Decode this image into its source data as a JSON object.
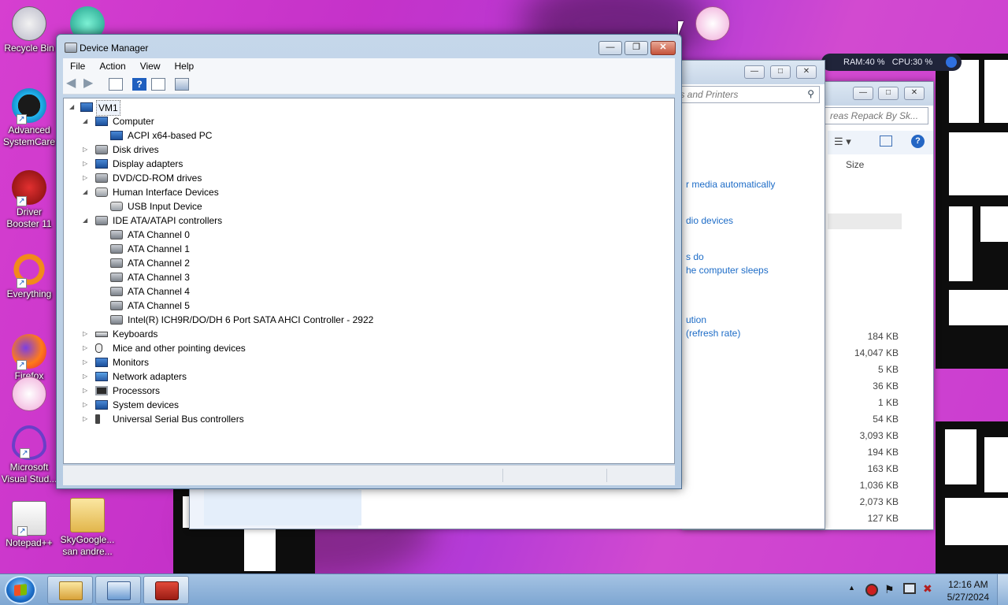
{
  "desktop": {
    "icons": [
      {
        "label": "Recycle Bin"
      },
      {
        "label": "Advanced SystemCare"
      },
      {
        "label": "Driver Booster 11"
      },
      {
        "label": "Everything"
      },
      {
        "label": "Firefox"
      },
      {
        "label": "Microsoft Visual Stud..."
      },
      {
        "label": "Notepad++"
      },
      {
        "label": "SkyGoogle... san andre..."
      }
    ]
  },
  "monitor_widget": {
    "ram": "RAM:40 %",
    "cpu": "CPU:30 %"
  },
  "back_window_1": {
    "search_placeholder": "ices and Printers",
    "links": [
      "r media automatically",
      "dio devices",
      "s do",
      "he computer sleeps",
      "ution",
      "(refresh rate)"
    ]
  },
  "back_window_2": {
    "search_placeholder": "reas Repack By Sk...",
    "column_size": "Size",
    "sizes": [
      "184 KB",
      "14,047 KB",
      "5 KB",
      "36 KB",
      "1 KB",
      "54 KB",
      "3,093 KB",
      "194 KB",
      "163 KB",
      "1,036 KB",
      "2,073 KB",
      "127 KB"
    ]
  },
  "device_manager": {
    "title": "Device Manager",
    "menu": [
      "File",
      "Action",
      "View",
      "Help"
    ],
    "tree": {
      "root": "VM1",
      "items": [
        {
          "label": "Computer",
          "level": 1,
          "expanded": true,
          "icon": "computer-icon"
        },
        {
          "label": "ACPI x64-based PC",
          "level": 2,
          "icon": "computer-icon"
        },
        {
          "label": "Disk drives",
          "level": 1,
          "expanded": false,
          "icon": "disk-icon"
        },
        {
          "label": "Display adapters",
          "level": 1,
          "expanded": false,
          "icon": "display-icon"
        },
        {
          "label": "DVD/CD-ROM drives",
          "level": 1,
          "expanded": false,
          "icon": "dvd-icon"
        },
        {
          "label": "Human Interface Devices",
          "level": 1,
          "expanded": true,
          "icon": "hid-icon"
        },
        {
          "label": "USB Input Device",
          "level": 2,
          "icon": "hid-icon"
        },
        {
          "label": "IDE ATA/ATAPI controllers",
          "level": 1,
          "expanded": true,
          "icon": "ide-icon"
        },
        {
          "label": "ATA Channel 0",
          "level": 2,
          "icon": "ide-icon"
        },
        {
          "label": "ATA Channel 1",
          "level": 2,
          "icon": "ide-icon"
        },
        {
          "label": "ATA Channel 2",
          "level": 2,
          "icon": "ide-icon"
        },
        {
          "label": "ATA Channel 3",
          "level": 2,
          "icon": "ide-icon"
        },
        {
          "label": "ATA Channel 4",
          "level": 2,
          "icon": "ide-icon"
        },
        {
          "label": "ATA Channel 5",
          "level": 2,
          "icon": "ide-icon"
        },
        {
          "label": "Intel(R) ICH9R/DO/DH 6 Port SATA AHCI Controller - 2922",
          "level": 2,
          "icon": "ide-icon"
        },
        {
          "label": "Keyboards",
          "level": 1,
          "expanded": false,
          "icon": "keyboard-icon"
        },
        {
          "label": "Mice and other pointing devices",
          "level": 1,
          "expanded": false,
          "icon": "mouse-icon"
        },
        {
          "label": "Monitors",
          "level": 1,
          "expanded": false,
          "icon": "monitor-icon"
        },
        {
          "label": "Network adapters",
          "level": 1,
          "expanded": false,
          "icon": "network-icon"
        },
        {
          "label": "Processors",
          "level": 1,
          "expanded": false,
          "icon": "processor-icon"
        },
        {
          "label": "System devices",
          "level": 1,
          "expanded": false,
          "icon": "system-icon"
        },
        {
          "label": "Universal Serial Bus controllers",
          "level": 1,
          "expanded": false,
          "icon": "usb-icon"
        }
      ]
    }
  },
  "taskbar": {
    "time": "12:16 AM",
    "date": "5/27/2024"
  }
}
